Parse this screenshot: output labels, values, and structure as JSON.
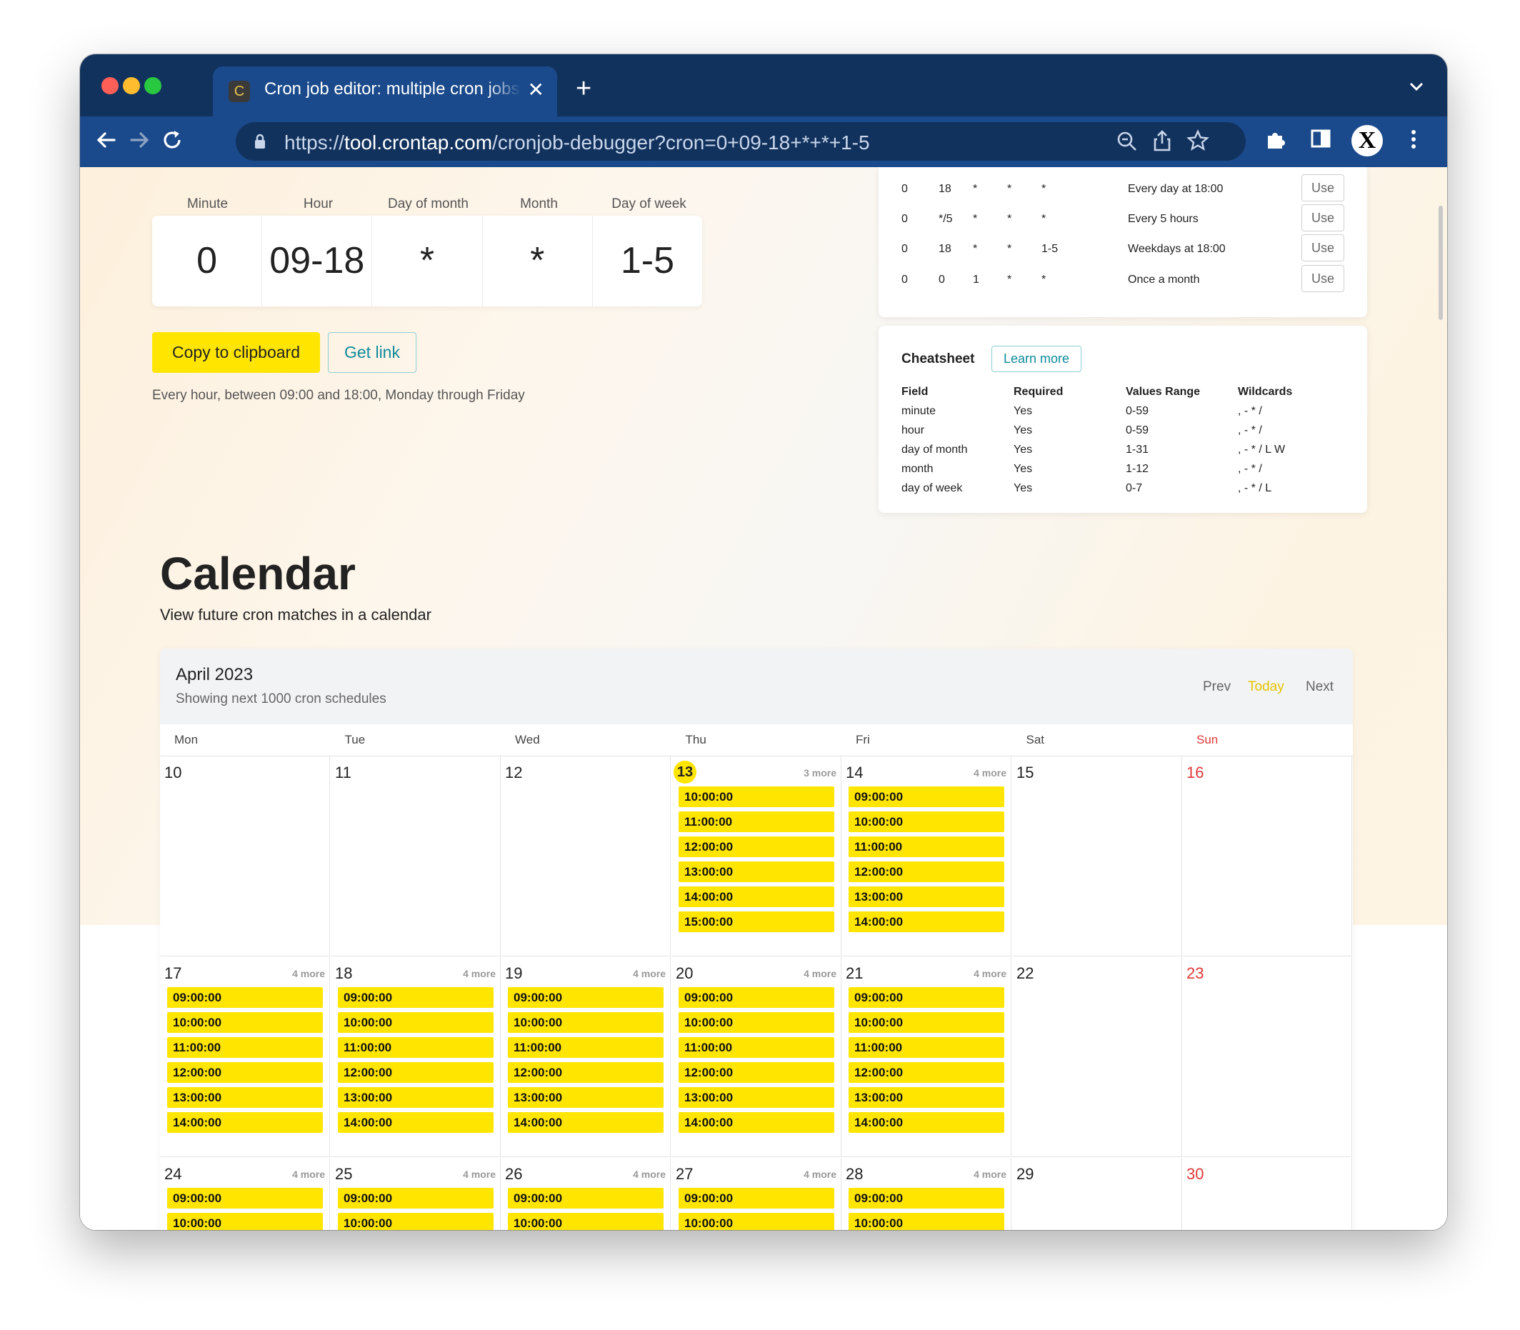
{
  "browser": {
    "tab_icon_letter": "C",
    "tab_title": "Cron job editor: multiple cron jobs",
    "tab_close": "✕",
    "new_tab": "+",
    "url_scheme": "https://",
    "url_host": "tool.crontap.com",
    "url_path": "/cronjob-debugger?cron=0+09-18+*+*+1-5",
    "profile_letter": "X"
  },
  "editor": {
    "labels": [
      "Minute",
      "Hour",
      "Day of month",
      "Month",
      "Day of week"
    ],
    "values": [
      "0",
      "09-18",
      "*",
      "*",
      "1-5"
    ],
    "copy_button": "Copy to clipboard",
    "link_button": "Get link",
    "description": "Every hour, between 09:00 and 18:00, Monday through Friday"
  },
  "examples": [
    {
      "cols": [
        "0",
        "18",
        "*",
        "*",
        "*"
      ],
      "desc": "Every day at 18:00",
      "button": "Use"
    },
    {
      "cols": [
        "0",
        "*/5",
        "*",
        "*",
        "*"
      ],
      "desc": "Every 5 hours",
      "button": "Use"
    },
    {
      "cols": [
        "0",
        "18",
        "*",
        "*",
        "1-5"
      ],
      "desc": "Weekdays at 18:00",
      "button": "Use"
    },
    {
      "cols": [
        "0",
        "0",
        "1",
        "*",
        "*"
      ],
      "desc": "Once a month",
      "button": "Use"
    }
  ],
  "cheatsheet": {
    "title": "Cheatsheet",
    "learn_more": "Learn more",
    "headers": [
      "Field",
      "Required",
      "Values Range",
      "Wildcards"
    ],
    "rows": [
      [
        "minute",
        "Yes",
        "0-59",
        ", - * /"
      ],
      [
        "hour",
        "Yes",
        "0-59",
        ", - * /"
      ],
      [
        "day of month",
        "Yes",
        "1-31",
        ", - * / L W"
      ],
      [
        "month",
        "Yes",
        "1-12",
        ", - * /"
      ],
      [
        "day of week",
        "Yes",
        "0-7",
        ", - * / L"
      ]
    ]
  },
  "calendar_section": {
    "title": "Calendar",
    "subtitle": "View future cron matches in a calendar"
  },
  "calendar": {
    "month": "April 2023",
    "count": "Showing next 1000 cron schedules",
    "nav": {
      "prev": "Prev",
      "today": "Today",
      "next": "Next"
    },
    "weekdays": [
      "Mon",
      "Tue",
      "Wed",
      "Thu",
      "Fri",
      "Sat",
      "Sun"
    ],
    "today_color": "#ffe500",
    "weeks": [
      [
        {
          "day": "10",
          "more": "",
          "events": []
        },
        {
          "day": "11",
          "more": "",
          "events": []
        },
        {
          "day": "12",
          "more": "",
          "events": []
        },
        {
          "day": "13",
          "today": true,
          "more": "3 more",
          "events": [
            "10:00:00",
            "11:00:00",
            "12:00:00",
            "13:00:00",
            "14:00:00",
            "15:00:00"
          ]
        },
        {
          "day": "14",
          "more": "4 more",
          "events": [
            "09:00:00",
            "10:00:00",
            "11:00:00",
            "12:00:00",
            "13:00:00",
            "14:00:00"
          ]
        },
        {
          "day": "15",
          "more": "",
          "events": []
        },
        {
          "day": "16",
          "more": "",
          "events": []
        }
      ],
      [
        {
          "day": "17",
          "more": "4 more",
          "events": [
            "09:00:00",
            "10:00:00",
            "11:00:00",
            "12:00:00",
            "13:00:00",
            "14:00:00"
          ]
        },
        {
          "day": "18",
          "more": "4 more",
          "events": [
            "09:00:00",
            "10:00:00",
            "11:00:00",
            "12:00:00",
            "13:00:00",
            "14:00:00"
          ]
        },
        {
          "day": "19",
          "more": "4 more",
          "events": [
            "09:00:00",
            "10:00:00",
            "11:00:00",
            "12:00:00",
            "13:00:00",
            "14:00:00"
          ]
        },
        {
          "day": "20",
          "more": "4 more",
          "events": [
            "09:00:00",
            "10:00:00",
            "11:00:00",
            "12:00:00",
            "13:00:00",
            "14:00:00"
          ]
        },
        {
          "day": "21",
          "more": "4 more",
          "events": [
            "09:00:00",
            "10:00:00",
            "11:00:00",
            "12:00:00",
            "13:00:00",
            "14:00:00"
          ]
        },
        {
          "day": "22",
          "more": "",
          "events": []
        },
        {
          "day": "23",
          "more": "",
          "events": []
        }
      ],
      [
        {
          "day": "24",
          "more": "4 more",
          "events": [
            "09:00:00",
            "10:00:00"
          ]
        },
        {
          "day": "25",
          "more": "4 more",
          "events": [
            "09:00:00",
            "10:00:00"
          ]
        },
        {
          "day": "26",
          "more": "4 more",
          "events": [
            "09:00:00",
            "10:00:00"
          ]
        },
        {
          "day": "27",
          "more": "4 more",
          "events": [
            "09:00:00",
            "10:00:00"
          ]
        },
        {
          "day": "28",
          "more": "4 more",
          "events": [
            "09:00:00",
            "10:00:00"
          ]
        },
        {
          "day": "29",
          "more": "",
          "events": []
        },
        {
          "day": "30",
          "more": "",
          "events": []
        }
      ]
    ]
  },
  "colors": {
    "accent_yellow": "#ffe500",
    "browser_blue": "#1a4a8b",
    "teal": "#0f8a9c",
    "sunday_red": "#e03838"
  }
}
